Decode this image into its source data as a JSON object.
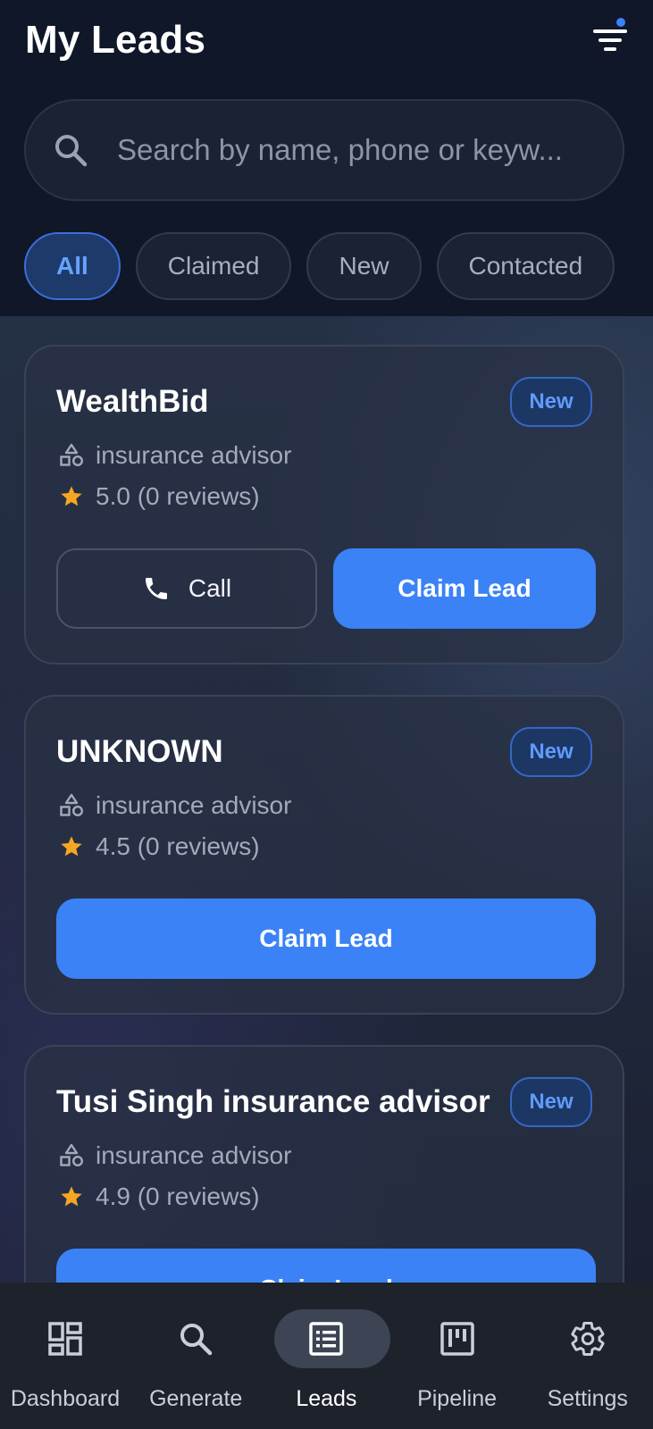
{
  "header": {
    "title": "My Leads",
    "filter_icon": "filter-icon"
  },
  "search": {
    "icon": "search-icon",
    "placeholder": "Search by name, phone or keyw..."
  },
  "filters": [
    {
      "label": "All",
      "active": true
    },
    {
      "label": "Claimed",
      "active": false
    },
    {
      "label": "New",
      "active": false
    },
    {
      "label": "Contacted",
      "active": false
    }
  ],
  "leads": [
    {
      "name": "WealthBid",
      "status": "New",
      "category": "insurance advisor",
      "rating_text": "5.0 (0 reviews)",
      "call_label": "Call",
      "claim_label": "Claim Lead"
    },
    {
      "name": "UNKNOWN",
      "status": "New",
      "category": "insurance advisor",
      "rating_text": "4.5 (0 reviews)",
      "claim_label": "Claim Lead"
    },
    {
      "name": "Tusi Singh insurance advisor",
      "status": "New",
      "category": "insurance advisor",
      "rating_text": "4.9 (0 reviews)",
      "claim_label": "Claim Lead"
    }
  ],
  "nav": [
    {
      "label": "Dashboard",
      "icon": "dashboard-icon",
      "active": false
    },
    {
      "label": "Generate",
      "icon": "search-icon",
      "active": false
    },
    {
      "label": "Leads",
      "icon": "list-icon",
      "active": true
    },
    {
      "label": "Pipeline",
      "icon": "pipeline-icon",
      "active": false
    },
    {
      "label": "Settings",
      "icon": "gear-icon",
      "active": false
    }
  ],
  "colors": {
    "accent": "#3b82f6",
    "star": "#f5a623",
    "background": "#101729"
  }
}
